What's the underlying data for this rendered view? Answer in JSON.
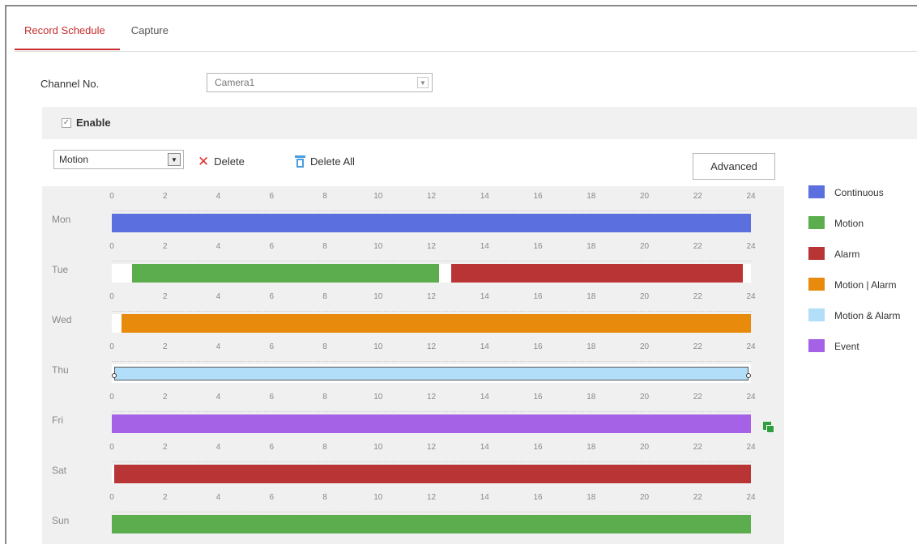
{
  "tabs": [
    {
      "label": "Record Schedule",
      "active": true
    },
    {
      "label": "Capture",
      "active": false
    }
  ],
  "channel": {
    "label": "Channel No.",
    "value": "Camera1"
  },
  "enable": {
    "label": "Enable",
    "checked": true
  },
  "toolbar": {
    "type_value": "Motion",
    "delete_label": "Delete",
    "delete_all_label": "Delete All",
    "advanced_label": "Advanced"
  },
  "colors": {
    "Continuous": "#5b6fde",
    "Motion": "#5cad4d",
    "Alarm": "#b93535",
    "Motion | Alarm": "#e88a0c",
    "Motion & Alarm": "#b2def9",
    "Event": "#a562e6"
  },
  "hours": [
    "0",
    "2",
    "4",
    "6",
    "8",
    "10",
    "12",
    "14",
    "16",
    "18",
    "20",
    "22",
    "24"
  ],
  "schedule": [
    {
      "day": "Mon",
      "segments": [
        {
          "type": "Continuous",
          "start": 0,
          "end": 24
        }
      ]
    },
    {
      "day": "Tue",
      "segments": [
        {
          "type": "Motion",
          "start": 0.75,
          "end": 12.3
        },
        {
          "type": "Alarm",
          "start": 12.75,
          "end": 23.7
        }
      ]
    },
    {
      "day": "Wed",
      "segments": [
        {
          "type": "Motion | Alarm",
          "start": 0.35,
          "end": 24
        }
      ]
    },
    {
      "day": "Thu",
      "segments": [
        {
          "type": "Motion & Alarm",
          "start": 0.1,
          "end": 23.9,
          "selected": true
        }
      ]
    },
    {
      "day": "Fri",
      "segments": [
        {
          "type": "Event",
          "start": 0,
          "end": 24
        }
      ]
    },
    {
      "day": "Sat",
      "segments": [
        {
          "type": "Alarm",
          "start": 0.1,
          "end": 24
        }
      ]
    },
    {
      "day": "Sun",
      "segments": [
        {
          "type": "Motion",
          "start": 0,
          "end": 24
        }
      ]
    }
  ],
  "legend": [
    {
      "label": "Continuous",
      "color": "#5b6fde"
    },
    {
      "label": "Motion",
      "color": "#5cad4d"
    },
    {
      "label": "Alarm",
      "color": "#b93535"
    },
    {
      "label": "Motion | Alarm",
      "color": "#e88a0c"
    },
    {
      "label": "Motion & Alarm",
      "color": "#b2def9"
    },
    {
      "label": "Event",
      "color": "#a562e6"
    }
  ],
  "icons": {
    "delete": "close-icon",
    "delete_all": "trash-icon",
    "copy": "copy-icon",
    "dropdown": "chevron-down-icon"
  }
}
